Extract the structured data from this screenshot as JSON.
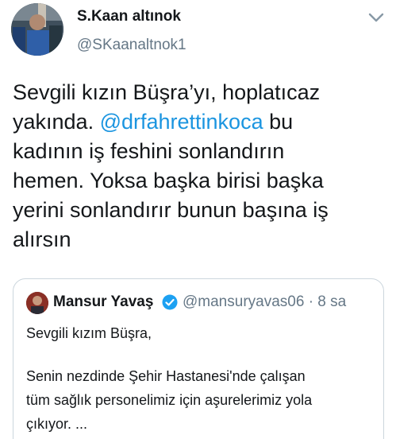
{
  "tweet": {
    "author": {
      "name": "S.Kaan altınok",
      "handle": "@SKaanaltnok1"
    },
    "text": {
      "line1": "Sevgili kızın Büşra’yı, hoplatıcaz",
      "line2_pre": "yakında. ",
      "line2_mention": "@drfahrettinkoca",
      "line2_post": " bu",
      "line3": "kadının iş feshini sonlandırın",
      "line4": "hemen. Yoksa başka birisi başka",
      "line5": "yerini sonlandırır bunun başına iş",
      "line6": "alırsın"
    },
    "menu_icon": "chevron-down-icon",
    "colors": {
      "mention": "#1b95e0",
      "secondary": "#657786",
      "border": "#ccd6dd",
      "verified": "#1da1f2"
    }
  },
  "quoted": {
    "author": {
      "name": "Mansur Yavaş",
      "handle_time": "@mansuryavas06 · 8 sa"
    },
    "verified_icon": "verified-badge-icon",
    "text": {
      "line1": "Sevgili kızım Büşra,",
      "line2": "Senin nezdinde Şehir Hastanesi'nde çalışan",
      "line3": "tüm sağlık personelimiz için aşurelerimiz yola",
      "line4": "çıkıyor. ..."
    }
  }
}
